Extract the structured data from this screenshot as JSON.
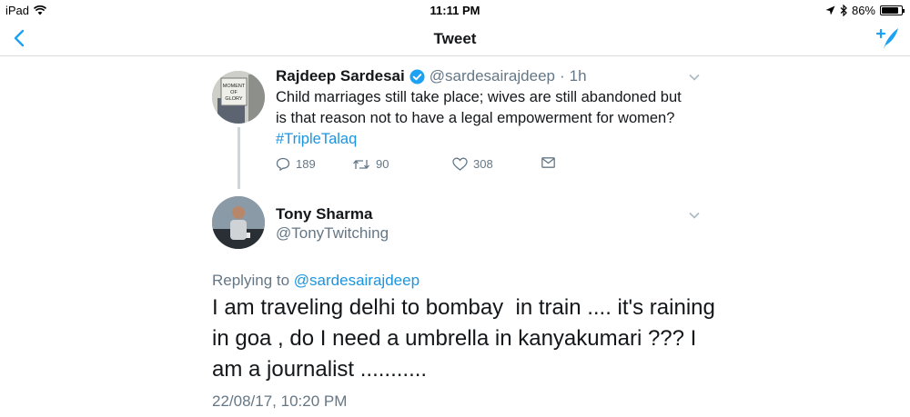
{
  "status_bar": {
    "device": "iPad",
    "time": "11:11 PM",
    "battery": "86%",
    "battery_level": 0.86,
    "icons": [
      "wifi-icon",
      "location-arrow-icon",
      "bluetooth-icon",
      "battery-icon"
    ]
  },
  "nav": {
    "title": "Tweet",
    "icons": [
      "back-chevron-icon",
      "compose-tweet-icon"
    ],
    "accent_color": "#1da1f2"
  },
  "tweet_parent": {
    "name": "Rajdeep Sardesai",
    "verified": true,
    "handle": "@sardesairajdeep",
    "separator": "·",
    "age": "1h",
    "avatar_text": [
      "MOMENT",
      "OF",
      "GLORY"
    ],
    "text_before": "Child marriages still take place; wives are still abandoned but is that reason not to have a legal empowerment for women? ",
    "hashtag": "#TripleTalaq",
    "replies": "189",
    "retweets": "90",
    "likes": "308"
  },
  "tweet_main": {
    "name": "Tony Sharma",
    "handle": "@TonyTwitching",
    "replying_prefix": "Replying to",
    "replying_to": "@sardesairajdeep",
    "text": "I am traveling delhi to bombay  in train .... it's raining in goa , do I need a umbrella in kanyakumari ??? I am a journalist ...........",
    "timestamp": "22/08/17, 10:20 PM"
  },
  "colors": {
    "link": "#1b95e0",
    "secondary_text": "#657786",
    "primary_text": "#14171a",
    "divider": "#d8dadd"
  }
}
